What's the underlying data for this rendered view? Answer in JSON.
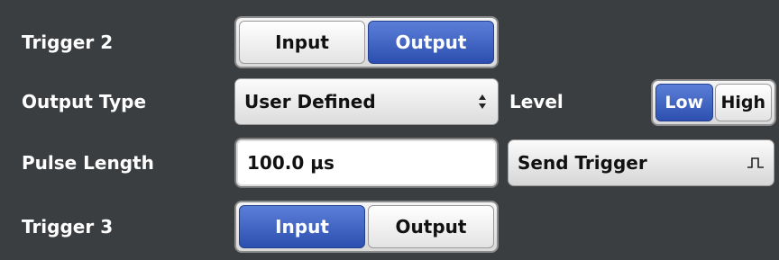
{
  "trigger2": {
    "label": "Trigger 2",
    "options": [
      "Input",
      "Output"
    ],
    "selected": "Output"
  },
  "output_type": {
    "label": "Output Type",
    "value": "User Defined",
    "arrow_icon": "updown-arrows-icon"
  },
  "level": {
    "label": "Level",
    "options": [
      "Low",
      "High"
    ],
    "selected": "Low"
  },
  "pulse_length": {
    "label": "Pulse Length",
    "value": "100.0 µs"
  },
  "send_trigger": {
    "label": "Send Trigger",
    "icon": "pulse-icon"
  },
  "trigger3": {
    "label": "Trigger 3",
    "options": [
      "Input",
      "Output"
    ],
    "selected": "Input"
  },
  "colors": {
    "background": "#3b3e40",
    "active_button": "#2d4fb0",
    "label_text": "#ffffff"
  }
}
